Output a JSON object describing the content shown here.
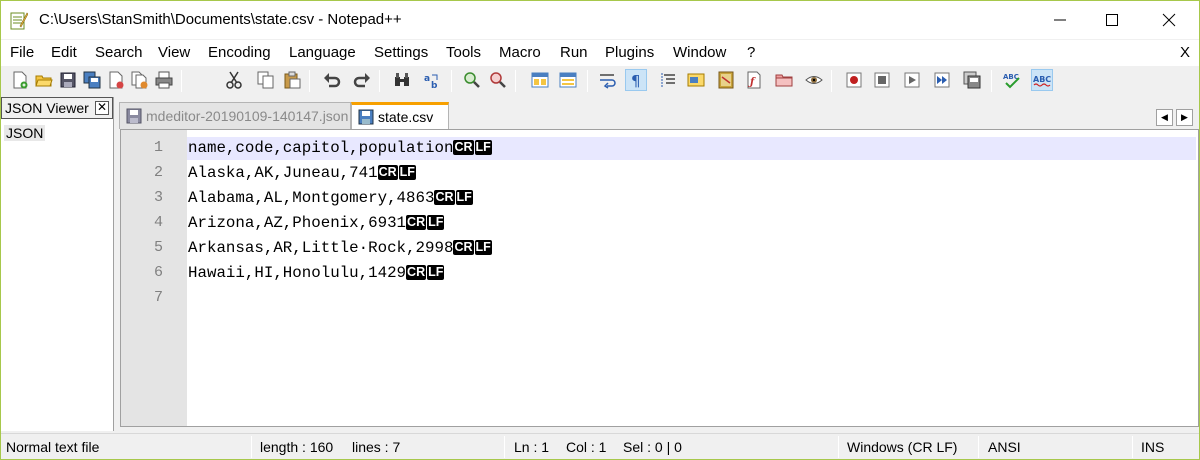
{
  "window": {
    "title": "C:\\Users\\StanSmith\\Documents\\state.csv - Notepad++"
  },
  "menu": {
    "items": [
      "File",
      "Edit",
      "Search",
      "View",
      "Encoding",
      "Language",
      "Settings",
      "Tools",
      "Macro",
      "Run",
      "Plugins",
      "Window",
      "?"
    ],
    "close_doc": "X"
  },
  "toolbar": {
    "buttons": [
      "new-file",
      "open-file",
      "save",
      "save-all",
      "close",
      "close-all",
      "print",
      "cut",
      "copy",
      "paste",
      "undo",
      "redo",
      "find",
      "replace",
      "zoom-in",
      "zoom-out",
      "sync-vertical",
      "sync-horizontal",
      "word-wrap",
      "show-all-characters",
      "indent-guide",
      "user-defined-language",
      "document-map",
      "function-list",
      "folder-as-workspace",
      "monitoring",
      "record-macro",
      "stop-recording",
      "play-macro",
      "run-macro-multiple",
      "save-macro",
      "spell-check",
      "spell-check-auto"
    ],
    "active": "show-all-characters"
  },
  "panel": {
    "title": "JSON Viewer",
    "close_label": "✕",
    "root": "JSON"
  },
  "tabs": [
    {
      "label": "mdeditor-20190109-140147.json",
      "active": false
    },
    {
      "label": "state.csv",
      "active": true
    }
  ],
  "editor": {
    "lines": [
      {
        "num": "1",
        "text": "name,code,capitol,population",
        "eol": true
      },
      {
        "num": "2",
        "text": "Alaska,AK,Juneau,741",
        "eol": true
      },
      {
        "num": "3",
        "text": "Alabama,AL,Montgomery,4863",
        "eol": true
      },
      {
        "num": "4",
        "text": "Arizona,AZ,Phoenix,6931",
        "eol": true
      },
      {
        "num": "5",
        "text": "Arkansas,AR,Little·Rock,2998",
        "eol": true
      },
      {
        "num": "6",
        "text": "Hawaii,HI,Honolulu,1429",
        "eol": true
      },
      {
        "num": "7",
        "text": "",
        "eol": false
      }
    ],
    "eol_cr": "CR",
    "eol_lf": "LF",
    "current_line": 1
  },
  "status": {
    "file_type": "Normal text file",
    "length": "length : 160",
    "lines": "lines : 7",
    "ln": "Ln : 1",
    "col": "Col : 1",
    "sel": "Sel : 0 | 0",
    "eol_format": "Windows (CR LF)",
    "encoding": "ANSI",
    "mode": "INS"
  },
  "colors": {
    "frame_border": "#a7c84b",
    "active_tab_accent": "#f7a000",
    "current_line": "#e8e8ff",
    "gutter": "#e4e4e4"
  }
}
